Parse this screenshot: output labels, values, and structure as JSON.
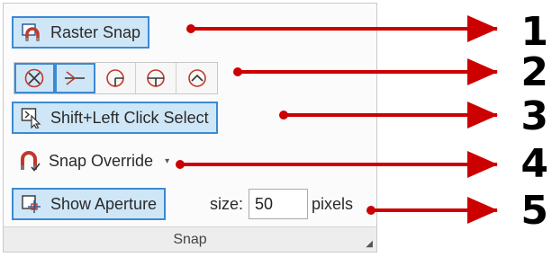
{
  "panel": {
    "title": "Snap",
    "launcher_icon": "dialog-launcher-icon"
  },
  "raster_snap": {
    "label": "Raster Snap",
    "icon": "magnet-icon",
    "active": true
  },
  "snap_modes": [
    {
      "name": "snap-mode-intersection",
      "icon": "circle-x-icon",
      "active": true
    },
    {
      "name": "snap-mode-perpendicular",
      "icon": "cross-arrow-icon",
      "active": true
    },
    {
      "name": "snap-mode-quadrant-left",
      "icon": "circle-quadrant-icon",
      "active": false
    },
    {
      "name": "snap-mode-center",
      "icon": "circle-line-icon",
      "active": false
    },
    {
      "name": "snap-mode-tangent",
      "icon": "circle-chevron-icon",
      "active": false
    }
  ],
  "shift_select": {
    "label": "Shift+Left Click Select",
    "icon": "cursor-select-icon",
    "active": true
  },
  "snap_override": {
    "label": "Snap Override",
    "icon": "magnet-check-icon",
    "caret": "▾"
  },
  "show_aperture": {
    "label": "Show Aperture",
    "icon": "aperture-icon",
    "active": true
  },
  "aperture_size": {
    "label": "size:",
    "value": "50",
    "unit": "pixels"
  },
  "callouts": [
    "1",
    "2",
    "3",
    "4",
    "5"
  ],
  "colors": {
    "accent": "#3b8ad4",
    "active_fill": "#cfe6f7",
    "arrow": "#cc0000"
  }
}
